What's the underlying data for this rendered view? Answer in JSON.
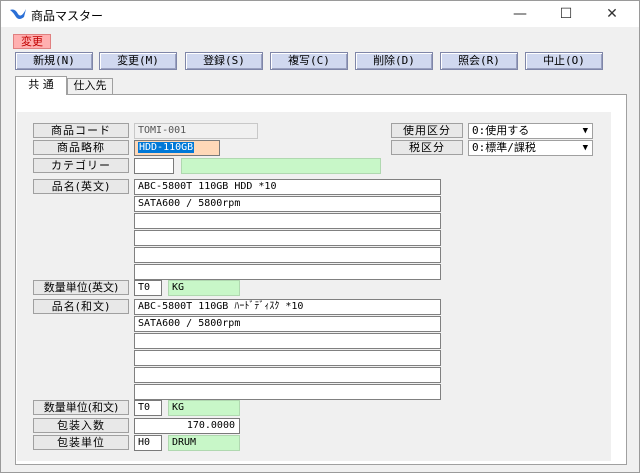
{
  "window": {
    "title": "商品マスター",
    "min": "—",
    "max": "☐",
    "close": "✕"
  },
  "mode_badge": "変更",
  "toolbar": [
    {
      "label": "新規(N)"
    },
    {
      "label": "変更(M)"
    },
    {
      "label": "登録(S)"
    },
    {
      "label": "複写(C)"
    },
    {
      "label": "削除(D)"
    },
    {
      "label": "照会(R)"
    },
    {
      "label": "中止(O)"
    }
  ],
  "tabs": [
    {
      "label": "共 通"
    },
    {
      "label": "仕入先"
    }
  ],
  "form": {
    "code_label": "商品コード",
    "code_value": "TOMI-001",
    "short_label": "商品略称",
    "short_value": "HDD-110GB",
    "category_label": "カテゴリー",
    "category_code": "",
    "category_name": "",
    "usage_label": "使用区分",
    "usage_value": "0:使用する",
    "tax_label": "税区分",
    "tax_value": "0:標準/課税",
    "name_en_label": "品名(英文)",
    "name_en_lines": [
      "ABC-5800T 110GB HDD *10",
      "SATA600 / 5800rpm",
      "",
      "",
      "",
      ""
    ],
    "unit_en_label": "数量単位(英文)",
    "unit_en_code": "T0",
    "unit_en_name": "KG",
    "name_jp_label": "品名(和文)",
    "name_jp_lines": [
      "ABC-5800T 110GB ﾊｰﾄﾞﾃﾞｨｽｸ *10",
      "SATA600 / 5800rpm",
      "",
      "",
      "",
      ""
    ],
    "unit_jp_label": "数量単位(和文)",
    "unit_jp_code": "T0",
    "unit_jp_name": "KG",
    "pack_qty_label": "包装入数",
    "pack_qty_value": "170.0000",
    "pack_unit_label": "包装単位",
    "pack_unit_code": "H0",
    "pack_unit_name": "DRUM"
  }
}
